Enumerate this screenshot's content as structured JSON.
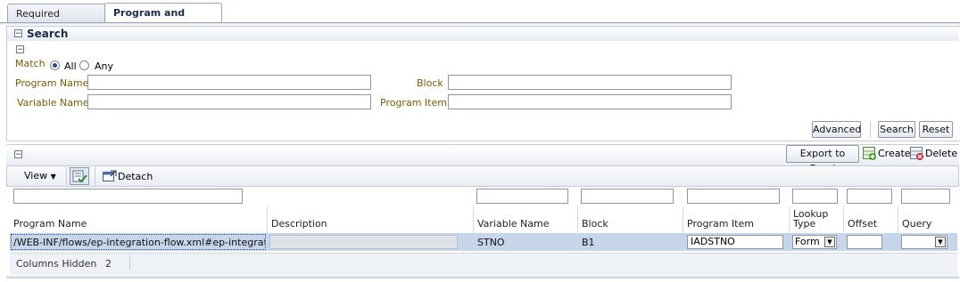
{
  "tabs": [
    {
      "label": "Required Variables"
    },
    {
      "label": "Program and Items"
    }
  ],
  "search": {
    "title": "Search",
    "match_label": "Match",
    "match_all": "All",
    "match_any": "Any",
    "program_name_label": "Program Name",
    "variable_name_label": "Variable Name",
    "block_label": "Block",
    "program_item_label": "Program Item",
    "program_name_value": "",
    "variable_name_value": "",
    "block_value": "",
    "program_item_value": "",
    "advanced_label": "Advanced",
    "search_label": "Search",
    "reset_label": "Reset"
  },
  "results": {
    "export_label": "Export to Excel",
    "create_label": "Create",
    "delete_label": "Delete",
    "view_label": "View",
    "detach_label": "Detach",
    "columns": [
      "Program Name",
      "Description",
      "Variable Name",
      "Block",
      "Program Item",
      "Lookup Type",
      "Offset",
      "Query"
    ],
    "lookup_type_line1": "Lookup",
    "lookup_type_line2": "Type",
    "row": {
      "program_name": "/WEB-INF/flows/ep-integration-flow.xml#ep-integration...",
      "description": "",
      "variable_name": "STNO",
      "block": "B1",
      "program_item": "IADSTNO",
      "lookup_type": "Form",
      "offset": "",
      "query": ""
    },
    "columns_hidden_label": "Columns Hidden",
    "columns_hidden_count": "2"
  },
  "colors": {
    "row_selected": "#c6d5ea",
    "border": "#c3ccd8"
  }
}
